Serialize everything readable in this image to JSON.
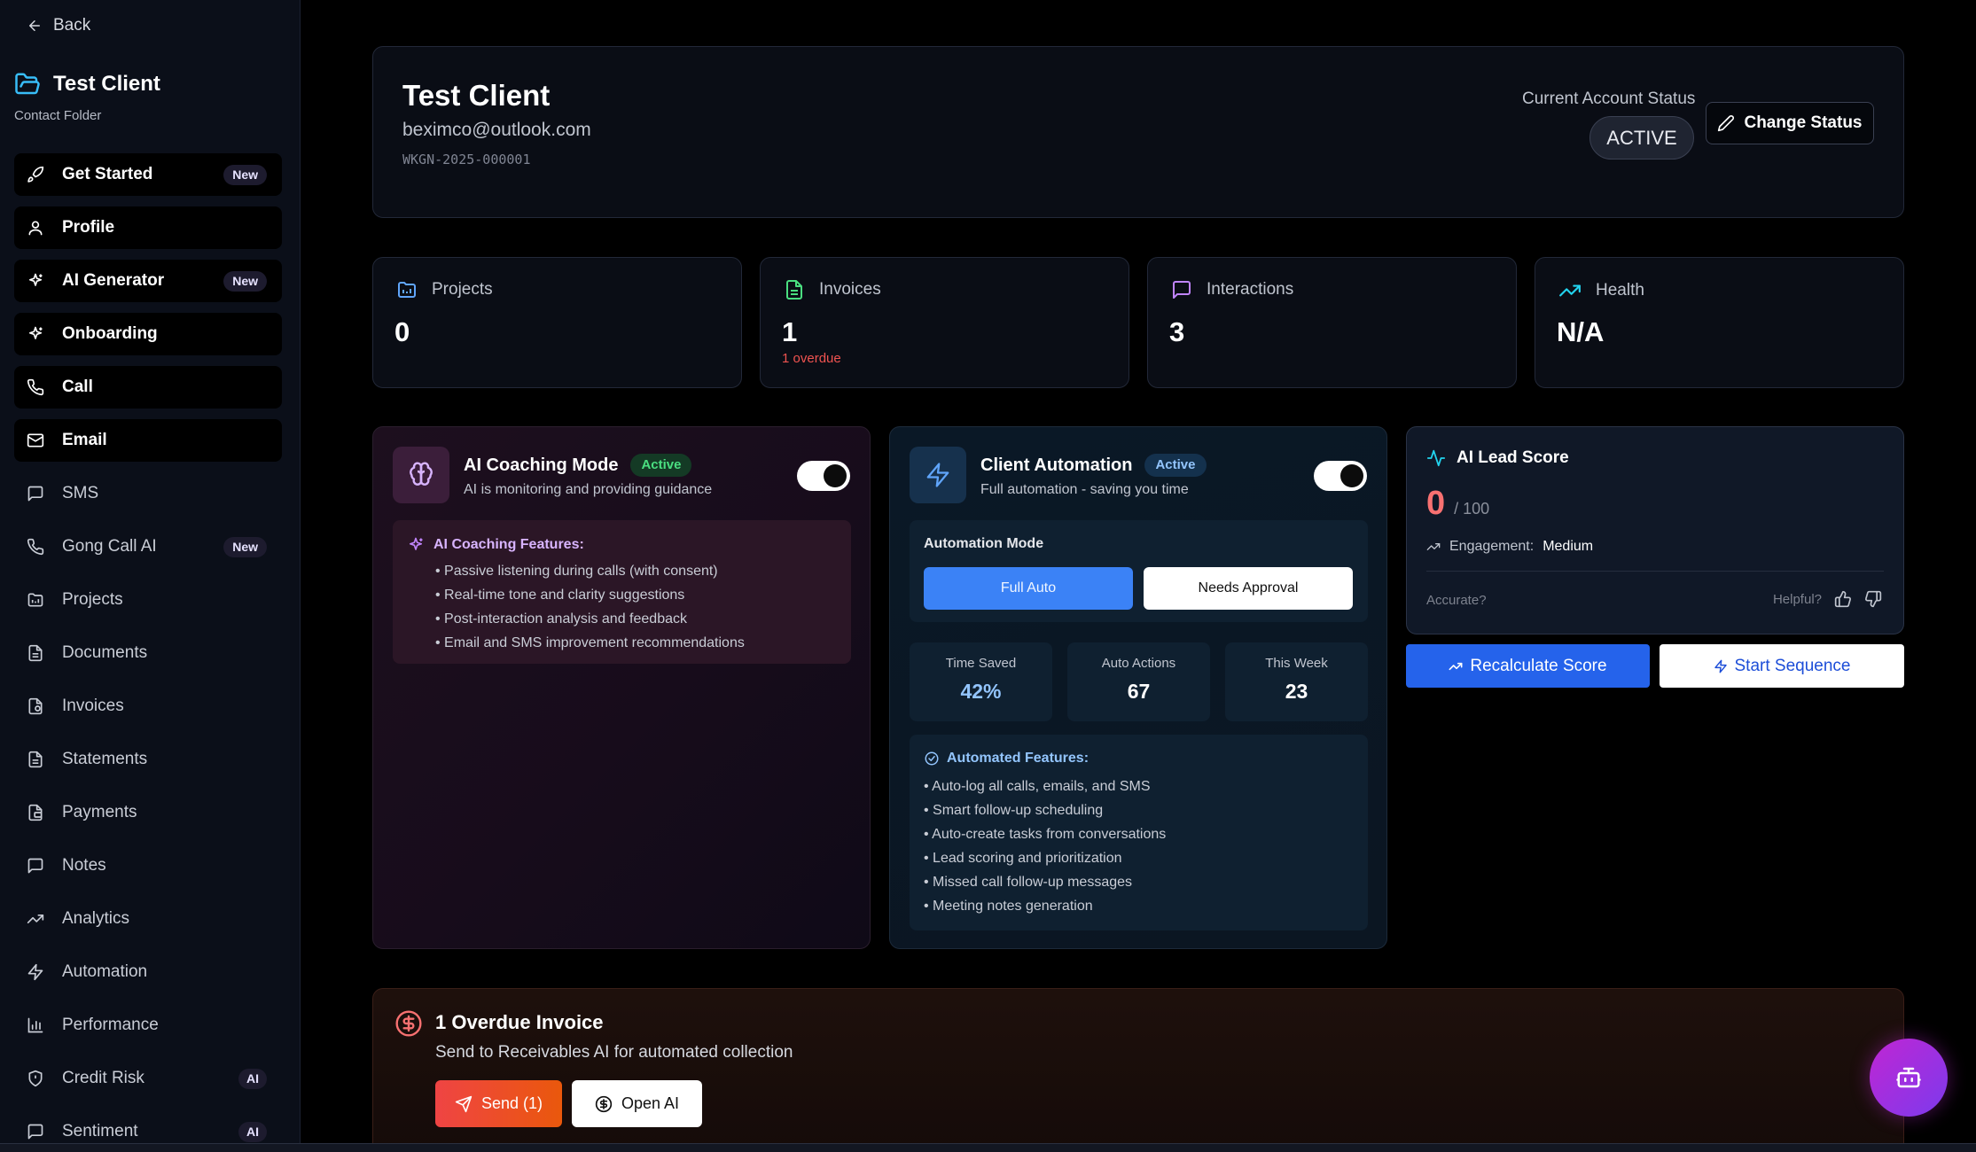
{
  "sidebar": {
    "back_label": "Back",
    "client_name": "Test Client",
    "client_sub": "Contact Folder",
    "items": [
      {
        "label": "Get Started",
        "badge": "New",
        "icon": "rocket-icon"
      },
      {
        "label": "Profile",
        "badge": "",
        "icon": "user-icon"
      },
      {
        "label": "AI Generator",
        "badge": "New",
        "icon": "sparkles-icon"
      },
      {
        "label": "Onboarding",
        "badge": "",
        "icon": "sparkles-icon"
      },
      {
        "label": "Call",
        "badge": "",
        "icon": "phone-icon"
      },
      {
        "label": "Email",
        "badge": "",
        "icon": "mail-icon"
      },
      {
        "label": "SMS",
        "badge": "",
        "icon": "message-icon"
      },
      {
        "label": "Gong Call AI",
        "badge": "New",
        "icon": "phone-icon"
      },
      {
        "label": "Projects",
        "badge": "",
        "icon": "folder-icon"
      },
      {
        "label": "Documents",
        "badge": "",
        "icon": "document-icon"
      },
      {
        "label": "Invoices",
        "badge": "",
        "icon": "invoice-icon"
      },
      {
        "label": "Statements",
        "badge": "",
        "icon": "document-icon"
      },
      {
        "label": "Payments",
        "badge": "",
        "icon": "wallet-icon"
      },
      {
        "label": "Notes",
        "badge": "",
        "icon": "message-icon"
      },
      {
        "label": "Analytics",
        "badge": "",
        "icon": "trend-icon"
      },
      {
        "label": "Automation",
        "badge": "",
        "icon": "bolt-icon"
      },
      {
        "label": "Performance",
        "badge": "",
        "icon": "bar-chart-icon"
      },
      {
        "label": "Credit Risk",
        "badge": "AI",
        "icon": "shield-icon"
      },
      {
        "label": "Sentiment",
        "badge": "AI",
        "icon": "message-icon"
      }
    ]
  },
  "header": {
    "title": "Test Client",
    "email": "beximco@outlook.com",
    "code": "WKGN-2025-000001",
    "status_label": "Current Account Status",
    "status": "ACTIVE",
    "change_status": "Change Status"
  },
  "stats": [
    {
      "label": "Projects",
      "value": "0",
      "sub": ""
    },
    {
      "label": "Invoices",
      "value": "1",
      "sub": "1 overdue"
    },
    {
      "label": "Interactions",
      "value": "3",
      "sub": ""
    },
    {
      "label": "Health",
      "value": "N/A",
      "sub": ""
    }
  ],
  "coaching": {
    "title": "AI Coaching Mode",
    "pill": "Active",
    "subtitle": "AI is monitoring and providing guidance",
    "features_title": "AI Coaching Features:",
    "features": [
      "• Passive listening during calls (with consent)",
      "• Real-time tone and clarity suggestions",
      "• Post-interaction analysis and feedback",
      "• Email and SMS improvement recommendations"
    ]
  },
  "automation": {
    "title": "Client Automation",
    "pill": "Active",
    "subtitle": "Full automation - saving you time",
    "mode_label": "Automation Mode",
    "mode_full": "Full Auto",
    "mode_approval": "Needs Approval",
    "metrics": [
      {
        "label": "Time Saved",
        "value": "42%"
      },
      {
        "label": "Auto Actions",
        "value": "67"
      },
      {
        "label": "This Week",
        "value": "23"
      }
    ],
    "features_title": "Automated Features:",
    "features": [
      "• Auto-log all calls, emails, and SMS",
      "• Smart follow-up scheduling",
      "• Auto-create tasks from conversations",
      "• Lead scoring and prioritization",
      "• Missed call follow-up messages",
      "• Meeting notes generation"
    ]
  },
  "lead": {
    "title": "AI Lead Score",
    "score": "0",
    "of": "/ 100",
    "engagement_label": "Engagement:",
    "engagement_value": "Medium",
    "accurate": "Accurate?",
    "helpful": "Helpful?",
    "recalc": "Recalculate Score",
    "sequence": "Start Sequence"
  },
  "overdue": {
    "title": "1 Overdue Invoice",
    "subtitle": "Send to Receivables AI for automated collection",
    "send": "Send (1)",
    "open": "Open AI"
  },
  "colors": {
    "accent_blue": "#2563eb",
    "active_green": "#4ade80",
    "danger": "#ef4444",
    "purple": "#c084fc"
  }
}
